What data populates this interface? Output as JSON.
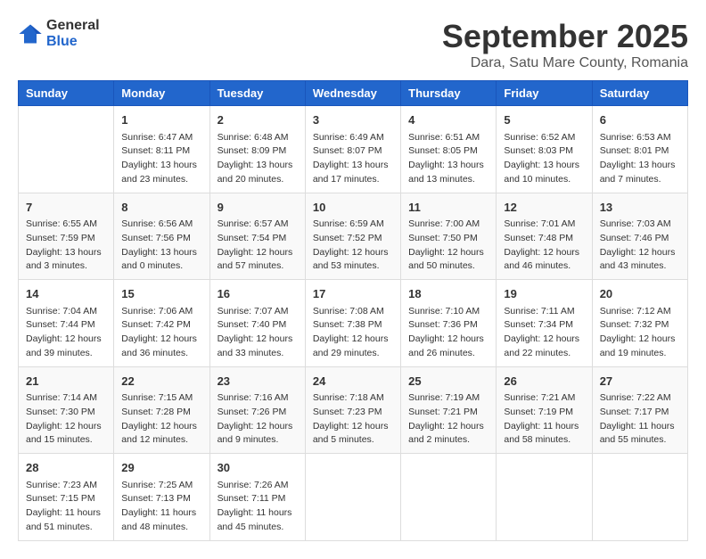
{
  "logo": {
    "general": "General",
    "blue": "Blue"
  },
  "title": "September 2025",
  "subtitle": "Dara, Satu Mare County, Romania",
  "headers": [
    "Sunday",
    "Monday",
    "Tuesday",
    "Wednesday",
    "Thursday",
    "Friday",
    "Saturday"
  ],
  "weeks": [
    [
      {
        "day": "",
        "info": ""
      },
      {
        "day": "1",
        "info": "Sunrise: 6:47 AM\nSunset: 8:11 PM\nDaylight: 13 hours and 23 minutes."
      },
      {
        "day": "2",
        "info": "Sunrise: 6:48 AM\nSunset: 8:09 PM\nDaylight: 13 hours and 20 minutes."
      },
      {
        "day": "3",
        "info": "Sunrise: 6:49 AM\nSunset: 8:07 PM\nDaylight: 13 hours and 17 minutes."
      },
      {
        "day": "4",
        "info": "Sunrise: 6:51 AM\nSunset: 8:05 PM\nDaylight: 13 hours and 13 minutes."
      },
      {
        "day": "5",
        "info": "Sunrise: 6:52 AM\nSunset: 8:03 PM\nDaylight: 13 hours and 10 minutes."
      },
      {
        "day": "6",
        "info": "Sunrise: 6:53 AM\nSunset: 8:01 PM\nDaylight: 13 hours and 7 minutes."
      }
    ],
    [
      {
        "day": "7",
        "info": "Sunrise: 6:55 AM\nSunset: 7:59 PM\nDaylight: 13 hours and 3 minutes."
      },
      {
        "day": "8",
        "info": "Sunrise: 6:56 AM\nSunset: 7:56 PM\nDaylight: 13 hours and 0 minutes."
      },
      {
        "day": "9",
        "info": "Sunrise: 6:57 AM\nSunset: 7:54 PM\nDaylight: 12 hours and 57 minutes."
      },
      {
        "day": "10",
        "info": "Sunrise: 6:59 AM\nSunset: 7:52 PM\nDaylight: 12 hours and 53 minutes."
      },
      {
        "day": "11",
        "info": "Sunrise: 7:00 AM\nSunset: 7:50 PM\nDaylight: 12 hours and 50 minutes."
      },
      {
        "day": "12",
        "info": "Sunrise: 7:01 AM\nSunset: 7:48 PM\nDaylight: 12 hours and 46 minutes."
      },
      {
        "day": "13",
        "info": "Sunrise: 7:03 AM\nSunset: 7:46 PM\nDaylight: 12 hours and 43 minutes."
      }
    ],
    [
      {
        "day": "14",
        "info": "Sunrise: 7:04 AM\nSunset: 7:44 PM\nDaylight: 12 hours and 39 minutes."
      },
      {
        "day": "15",
        "info": "Sunrise: 7:06 AM\nSunset: 7:42 PM\nDaylight: 12 hours and 36 minutes."
      },
      {
        "day": "16",
        "info": "Sunrise: 7:07 AM\nSunset: 7:40 PM\nDaylight: 12 hours and 33 minutes."
      },
      {
        "day": "17",
        "info": "Sunrise: 7:08 AM\nSunset: 7:38 PM\nDaylight: 12 hours and 29 minutes."
      },
      {
        "day": "18",
        "info": "Sunrise: 7:10 AM\nSunset: 7:36 PM\nDaylight: 12 hours and 26 minutes."
      },
      {
        "day": "19",
        "info": "Sunrise: 7:11 AM\nSunset: 7:34 PM\nDaylight: 12 hours and 22 minutes."
      },
      {
        "day": "20",
        "info": "Sunrise: 7:12 AM\nSunset: 7:32 PM\nDaylight: 12 hours and 19 minutes."
      }
    ],
    [
      {
        "day": "21",
        "info": "Sunrise: 7:14 AM\nSunset: 7:30 PM\nDaylight: 12 hours and 15 minutes."
      },
      {
        "day": "22",
        "info": "Sunrise: 7:15 AM\nSunset: 7:28 PM\nDaylight: 12 hours and 12 minutes."
      },
      {
        "day": "23",
        "info": "Sunrise: 7:16 AM\nSunset: 7:26 PM\nDaylight: 12 hours and 9 minutes."
      },
      {
        "day": "24",
        "info": "Sunrise: 7:18 AM\nSunset: 7:23 PM\nDaylight: 12 hours and 5 minutes."
      },
      {
        "day": "25",
        "info": "Sunrise: 7:19 AM\nSunset: 7:21 PM\nDaylight: 12 hours and 2 minutes."
      },
      {
        "day": "26",
        "info": "Sunrise: 7:21 AM\nSunset: 7:19 PM\nDaylight: 11 hours and 58 minutes."
      },
      {
        "day": "27",
        "info": "Sunrise: 7:22 AM\nSunset: 7:17 PM\nDaylight: 11 hours and 55 minutes."
      }
    ],
    [
      {
        "day": "28",
        "info": "Sunrise: 7:23 AM\nSunset: 7:15 PM\nDaylight: 11 hours and 51 minutes."
      },
      {
        "day": "29",
        "info": "Sunrise: 7:25 AM\nSunset: 7:13 PM\nDaylight: 11 hours and 48 minutes."
      },
      {
        "day": "30",
        "info": "Sunrise: 7:26 AM\nSunset: 7:11 PM\nDaylight: 11 hours and 45 minutes."
      },
      {
        "day": "",
        "info": ""
      },
      {
        "day": "",
        "info": ""
      },
      {
        "day": "",
        "info": ""
      },
      {
        "day": "",
        "info": ""
      }
    ]
  ]
}
